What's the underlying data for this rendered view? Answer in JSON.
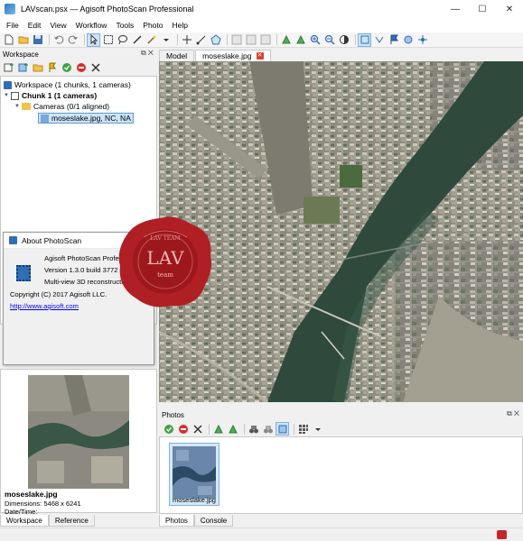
{
  "window": {
    "title": "LAVscan.psx — Agisoft PhotoScan Professional",
    "controls": [
      "—",
      "☐",
      "✕"
    ]
  },
  "menu": [
    "File",
    "Edit",
    "View",
    "Workflow",
    "Tools",
    "Photo",
    "Help"
  ],
  "workspace_panel": {
    "title": "Workspace",
    "tree": {
      "root": "Workspace (1 chunks, 1 cameras)",
      "chunk": "Chunk 1 (1 cameras)",
      "cameras": "Cameras (0/1 aligned)",
      "photo": "moseslake.jpg, NC, NA"
    }
  },
  "about": {
    "title": "About PhotoScan",
    "product": "Agisoft PhotoScan Professional",
    "version": "Version 1.3.0 build 3772 (64 bit)",
    "description": "Multi-view 3D reconstruction",
    "copyright": "Copyright (C) 2017 Agisoft LLC.",
    "link": "http://www.agisoft.com"
  },
  "preview": {
    "filename": "moseslake.jpg",
    "dimensions": "Dimensions: 5468 x 6241",
    "datetime": "Date/Time:"
  },
  "left_tabs": [
    "Workspace",
    "Reference"
  ],
  "view_tabs": [
    "Model",
    "moseslake.jpg"
  ],
  "photos_panel": {
    "title": "Photos",
    "thumbnail_label": "moseslake.jpg"
  },
  "right_tabs": [
    "Photos",
    "Console"
  ],
  "seal": {
    "text": "LAV",
    "subtext": "team",
    "rim_text": "LAV TEAM"
  },
  "colors": {
    "accent": "#2f6fb5",
    "selection": "#cce4f7",
    "seal_red": "#b01f24",
    "river": "#2f4a3c"
  }
}
